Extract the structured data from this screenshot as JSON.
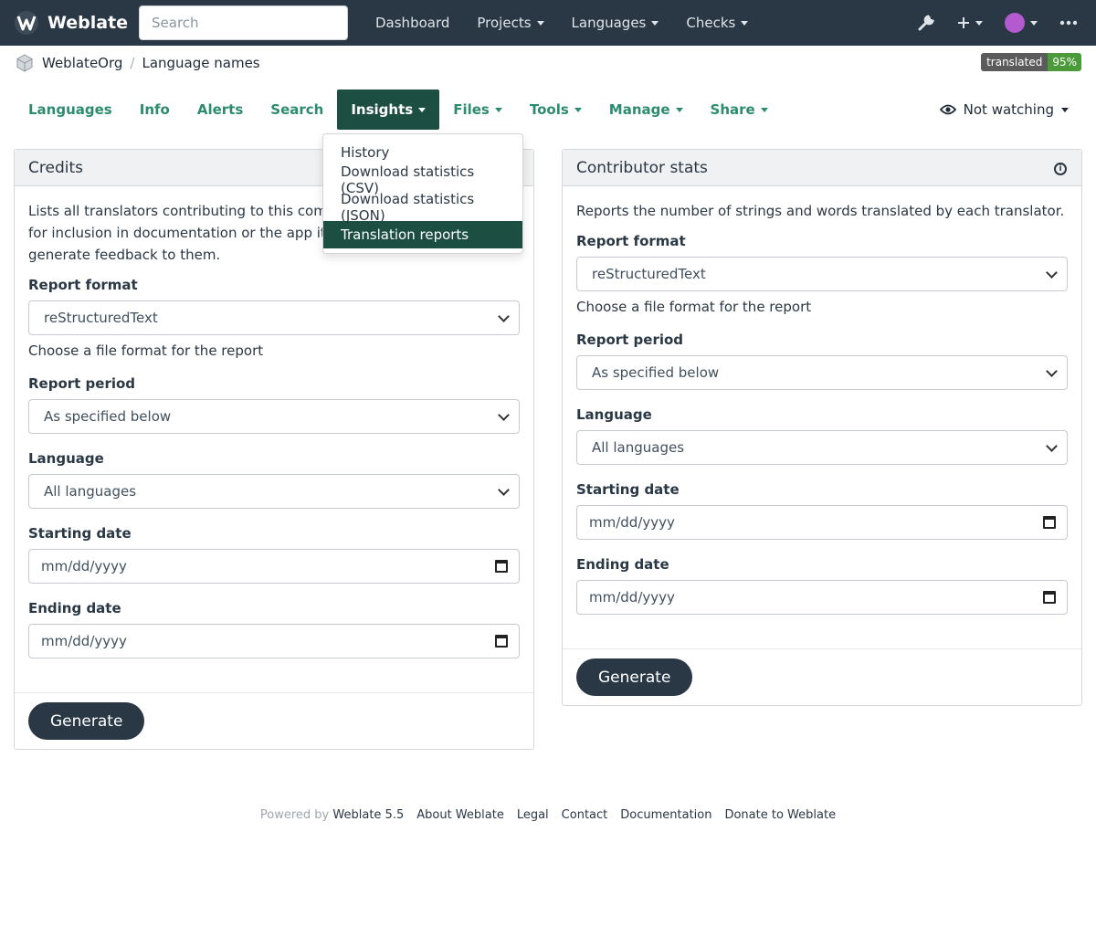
{
  "brand": {
    "name": "Weblate"
  },
  "search": {
    "placeholder": "Search"
  },
  "nav": {
    "items": [
      "Dashboard",
      "Projects",
      "Languages",
      "Checks"
    ]
  },
  "breadcrumb": {
    "project": "WeblateOrg",
    "component": "Language names"
  },
  "badge": {
    "label": "translated",
    "value": "95%"
  },
  "tabs": [
    "Languages",
    "Info",
    "Alerts",
    "Search",
    "Insights",
    "Files",
    "Tools",
    "Manage",
    "Share"
  ],
  "watch": {
    "label": "Not watching"
  },
  "dropdown": {
    "items": [
      "History",
      "Download statistics (CSV)",
      "Download statistics (JSON)",
      "Translation reports"
    ]
  },
  "credits": {
    "title": "Credits",
    "desc_line1": "Lists all translators contributing to this compone",
    "desc_line2": "for inclusion in documentation or the app itself, t",
    "desc_line3": "generate feedback to them.",
    "format_label": "Report format",
    "format_value": "reStructuredText",
    "format_help": "Choose a file format for the report",
    "period_label": "Report period",
    "period_value": "As specified below",
    "language_label": "Language",
    "language_value": "All languages",
    "start_label": "Starting date",
    "start_value": "mm/dd/yyyy",
    "end_label": "Ending date",
    "end_value": "mm/dd/yyyy",
    "button": "Generate"
  },
  "stats": {
    "title": "Contributor stats",
    "desc": "Reports the number of strings and words translated by each translator.",
    "format_label": "Report format",
    "format_value": "reStructuredText",
    "format_help": "Choose a file format for the report",
    "period_label": "Report period",
    "period_value": "As specified below",
    "language_label": "Language",
    "language_value": "All languages",
    "start_label": "Starting date",
    "start_value": "mm/dd/yyyy",
    "end_label": "Ending date",
    "end_value": "mm/dd/yyyy",
    "button": "Generate"
  },
  "footer": {
    "powered": "Powered by",
    "version": "Weblate 5.5",
    "links": [
      "About Weblate",
      "Legal",
      "Contact",
      "Documentation",
      "Donate to Weblate"
    ]
  },
  "colors": {
    "navbar": "#2a3744",
    "accent": "#2c8c6b",
    "active": "#1c4e42"
  }
}
